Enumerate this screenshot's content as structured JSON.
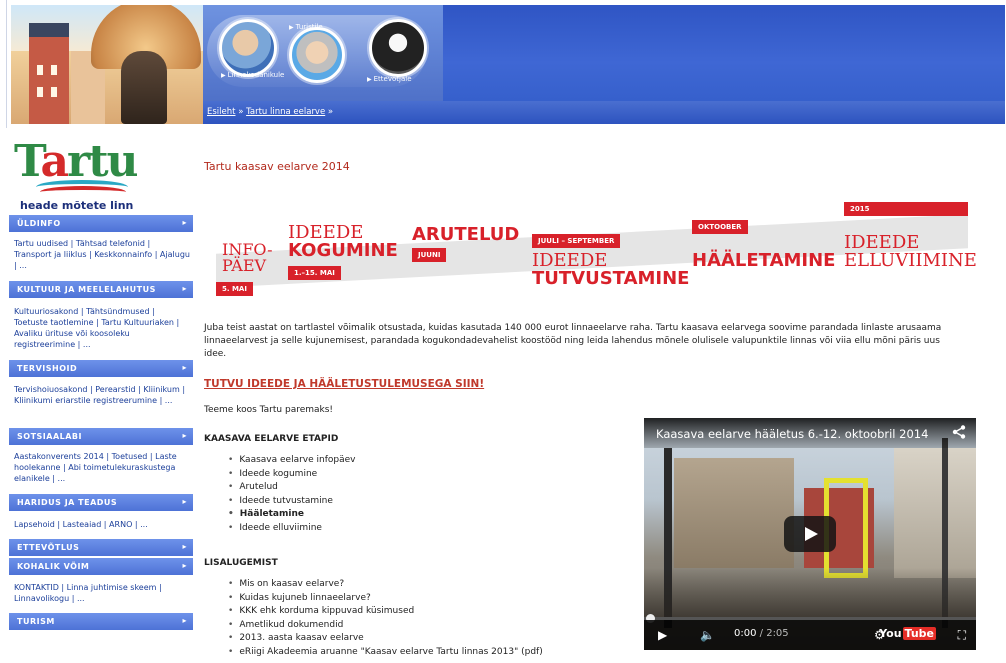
{
  "header": {
    "nav_labels": [
      "Linnakodanikule",
      "Turistile",
      "Ettevõtjale"
    ],
    "breadcrumb": [
      "Esileht",
      "Tartu linna eelarve"
    ],
    "breadcrumb_sep": "»"
  },
  "sidebar": {
    "logo_word": "Tartu",
    "motto": "heade mõtete linn",
    "sections": [
      {
        "title": "ÜLDINFO",
        "body": "Tartu uudised | Tähtsad telefonid | Transport ja liiklus | Keskkonnainfo | Ajalugu | ..."
      },
      {
        "title": "KULTUUR JA MEELELAHUTUS",
        "body": "Kultuuriosakond | Tähtsündmused | Toetuste taotlemine | Tartu Kultuuriaken | Avaliku ürituse või koosoleku registreerimine | ..."
      },
      {
        "title": "TERVISHOID",
        "body": "Tervishoiuosakond | Perearstid | Kliinikum | Kliinikumi eriarstile registreerumine | ..."
      },
      {
        "title": "SOTSIAALABI",
        "body": "Aastakonverents 2014 | Toetused | Laste hoolekanne | Abi toimetulekuraskustega elanikele | ..."
      },
      {
        "title": "HARIDUS JA TEADUS",
        "body": "Lapsehoid | Lasteaiad | ARNO | ..."
      },
      {
        "title": "ETTEVÕTLUS",
        "body": ""
      },
      {
        "title": "KOHALIK VÕIM",
        "body": "KONTAKTID | Linna juhtimise skeem | Linnavolikogu | ..."
      },
      {
        "title": "TURISM",
        "body": ""
      }
    ]
  },
  "main": {
    "title": "Tartu kaasav eelarve 2014",
    "timeline": {
      "infopaev": "INFO-\nPÄEV",
      "may5": "5. MAI",
      "ideede1": "IDEEDE",
      "kogumine": "KOGUMINE",
      "may1_15": "1.–15. MAI",
      "arutelud": "ARUTELUD",
      "juuni": "JUUNI",
      "juuli_sept": "JUULI – SEPTEMBER",
      "ideede2": "IDEEDE",
      "tutvustamine": "TUTVUSTAMINE",
      "oktoober": "OKTOOBER",
      "haaletamine": "HÄÄLETAMINE",
      "year2015": "2015",
      "ideede3": "IDEEDE",
      "elluviimine": "ELLUVIIMINE"
    },
    "intro": "Juba teist aastat on tartlastel võimalik otsustada, kuidas kasutada 140 000 eurot linnaeelarve raha. Tartu kaasava eelarvega soovime parandada linlaste arusaama linnaeelarvest ja selle kujunemisest, parandada kogukondadevahelist koostööd ning leida lahendus mõnele olulisele valupunktile linnas või viia ellu mõni päris uus idee.",
    "cta": "TUTVU IDEEDE JA HÄÄLETUSTULEMUSEGA SIIN!",
    "slogan": "Teeme koos Tartu paremaks!",
    "etapid_heading": "KAASAVA EELARVE ETAPID",
    "etapid": [
      "Kaasava eelarve infopäev",
      "Ideede kogumine",
      "Arutelud",
      "Ideede tutvustamine",
      "Hääletamine",
      "Ideede elluviimine"
    ],
    "lisa_heading": "LISALUGEMIST",
    "lisa": [
      "Mis on kaasav eelarve?",
      "Kuidas kujuneb linnaeelarve?",
      "KKK ehk korduma kippuvad küsimused",
      "Ametlikud dokumendid",
      "2013. aasta kaasav eelarve",
      "eRiigi Akadeemia aruanne \"Kaasav eelarve Tartu linnas 2013\" (pdf)"
    ]
  },
  "video": {
    "title": "Kaasava eelarve hääletus 6.-12. oktoobril 2014",
    "time_current": "0:00",
    "time_total": "/ 2:05",
    "youtube_you": "You",
    "youtube_tube": "Tube",
    "progress": 0
  }
}
